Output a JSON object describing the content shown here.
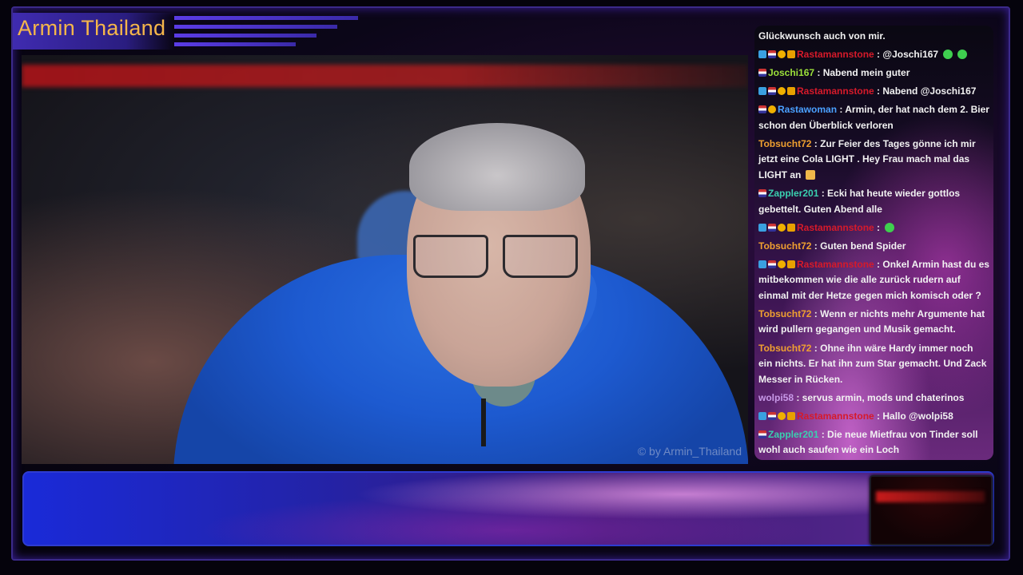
{
  "stream": {
    "title": "Armin Thailand",
    "watermark": "© by Armin_Thailand"
  },
  "chat": {
    "messages": [
      {
        "user": "",
        "user_color": "#f2f2f2",
        "badges": [],
        "text": "Glückwunsch auch von mir.",
        "emotes": []
      },
      {
        "user": "Rastamannstone",
        "user_color": "#d61a2a",
        "badges": [
          "mod",
          "flag",
          "gold",
          "crown"
        ],
        "text": ": @Joschi167",
        "emotes": [
          "green-emote",
          "green-emote"
        ]
      },
      {
        "user": "Joschi167",
        "user_color": "#9be03a",
        "badges": [
          "flag"
        ],
        "text": ": Nabend mein guter",
        "emotes": []
      },
      {
        "user": "Rastamannstone",
        "user_color": "#d61a2a",
        "badges": [
          "mod",
          "flag",
          "gold",
          "crown"
        ],
        "text": ": Nabend @Joschi167",
        "emotes": []
      },
      {
        "user": "Rastawoman",
        "user_color": "#4aa0ff",
        "badges": [
          "flag",
          "gold"
        ],
        "text": ": Armin, der hat nach dem 2. Bier schon den Überblick verloren",
        "emotes": []
      },
      {
        "user": "Tobsucht72",
        "user_color": "#f0a030",
        "badges": [],
        "text": ": Zur Feier des Tages gönne ich mir jetzt eine Cola LIGHT . Hey Frau mach mal das LIGHT an",
        "emotes": [
          "gift-emote"
        ]
      },
      {
        "user": "Zappler201",
        "user_color": "#3ad0b0",
        "badges": [
          "flag"
        ],
        "text": ": Ecki hat heute wieder gottlos gebettelt. Guten Abend alle",
        "emotes": []
      },
      {
        "user": "Rastamannstone",
        "user_color": "#d61a2a",
        "badges": [
          "mod",
          "flag",
          "gold",
          "crown"
        ],
        "text": ":",
        "emotes": [
          "green-emote"
        ]
      },
      {
        "user": "Tobsucht72",
        "user_color": "#f0a030",
        "badges": [],
        "text": ": Guten bend Spider",
        "emotes": []
      },
      {
        "user": "Rastamannstone",
        "user_color": "#d61a2a",
        "badges": [
          "mod",
          "flag",
          "gold",
          "crown"
        ],
        "text": ": Onkel Armin hast du es mitbekommen wie die alle zurück rudern auf einmal mit der Hetze gegen mich komisch oder ?",
        "emotes": []
      },
      {
        "user": "Tobsucht72",
        "user_color": "#f0a030",
        "badges": [],
        "text": ": Wenn er nichts mehr Argumente hat wird pullern gegangen und Musik gemacht.",
        "emotes": []
      },
      {
        "user": "Tobsucht72",
        "user_color": "#f0a030",
        "badges": [],
        "text": ": Ohne ihn wäre Hardy immer noch ein nichts. Er hat ihn zum Star gemacht. Und Zack Messer in Rücken.",
        "emotes": []
      },
      {
        "user": "wolpi58",
        "user_color": "#c89ae8",
        "badges": [],
        "text": ": servus armin, mods und chaterinos",
        "emotes": []
      },
      {
        "user": "Rastamannstone",
        "user_color": "#d61a2a",
        "badges": [
          "mod",
          "flag",
          "gold",
          "crown"
        ],
        "text": ": Hallo @wolpi58",
        "emotes": []
      },
      {
        "user": "Zappler201",
        "user_color": "#3ad0b0",
        "badges": [
          "flag"
        ],
        "text": ": Die neue Mietfrau von Tinder soll wohl auch saufen wie ein Loch",
        "emotes": []
      }
    ]
  }
}
